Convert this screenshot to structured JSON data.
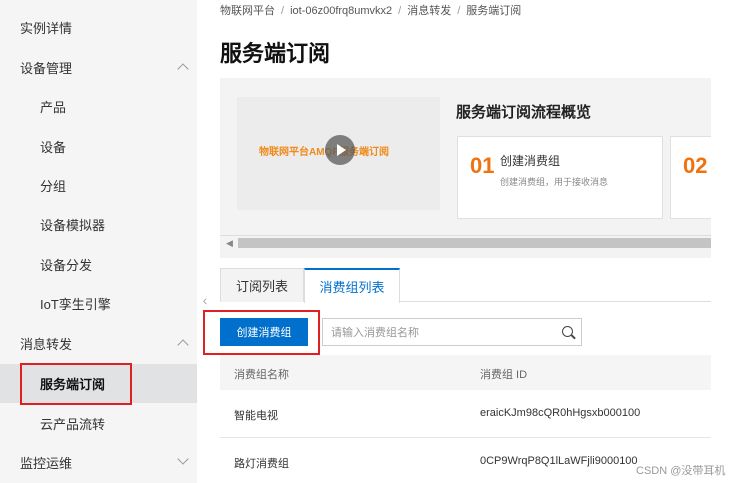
{
  "sidebar": {
    "items": [
      {
        "label": "实例详情",
        "kind": "group"
      },
      {
        "label": "设备管理",
        "kind": "group",
        "chevron": "up"
      },
      {
        "label": "产品",
        "kind": "sub"
      },
      {
        "label": "设备",
        "kind": "sub"
      },
      {
        "label": "分组",
        "kind": "sub"
      },
      {
        "label": "设备模拟器",
        "kind": "sub"
      },
      {
        "label": "设备分发",
        "kind": "sub"
      },
      {
        "label": "IoT孪生引擎",
        "kind": "sub"
      },
      {
        "label": "消息转发",
        "kind": "group",
        "chevron": "up"
      },
      {
        "label": "服务端订阅",
        "kind": "sub",
        "active": true
      },
      {
        "label": "云产品流转",
        "kind": "sub"
      },
      {
        "label": "监控运维",
        "kind": "group",
        "chevron": "down"
      }
    ],
    "collapse_icon": "‹"
  },
  "breadcrumb": {
    "items": [
      "物联网平台",
      "iot-06z00frq8umvkx2",
      "消息转发",
      "服务端订阅"
    ],
    "separator": "/"
  },
  "page_title": "服务端订阅",
  "overview": {
    "video_caption": "物联网平台AMQP服务端订阅",
    "title": "服务端订阅流程概览",
    "steps": [
      {
        "num": "01",
        "title": "创建消费组",
        "desc": "创建消费组，用于接收消息"
      },
      {
        "num": "02",
        "title": "",
        "desc": ""
      }
    ]
  },
  "tabs": [
    {
      "label": "订阅列表",
      "active": false
    },
    {
      "label": "消费组列表",
      "active": true
    }
  ],
  "toolbar": {
    "create_label": "创建消费组",
    "search_placeholder": "请输入消费组名称"
  },
  "table": {
    "columns": [
      "消费组名称",
      "消费组 ID"
    ],
    "rows": [
      [
        "智能电视",
        "eraicKJm98cQR0hHgsxb000100"
      ],
      [
        "路灯消费组",
        "0CP9WrqP8Q1lLaWFjli9000100"
      ]
    ]
  },
  "watermark": "CSDN @没带耳机",
  "colors": {
    "accent": "#0070cc",
    "highlight": "#e02020",
    "step_number": "#f0720f"
  }
}
